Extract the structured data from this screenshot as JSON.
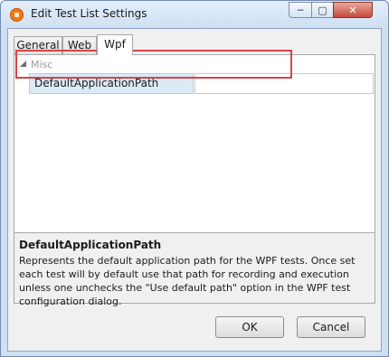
{
  "window": {
    "title": "Edit Test List Settings",
    "app_icon": "test-studio-icon",
    "controls": {
      "minimize_glyph": "─",
      "maximize_glyph": "▢",
      "close_glyph": "✕"
    }
  },
  "tabs": [
    {
      "label": "General",
      "selected": false
    },
    {
      "label": "Web",
      "selected": false
    },
    {
      "label": "Wpf",
      "selected": true
    }
  ],
  "property_grid": {
    "category": "Misc",
    "rows": [
      {
        "name": "DefaultApplicationPath",
        "value": ""
      }
    ]
  },
  "description": {
    "title": "DefaultApplicationPath",
    "text": "Represents the default application path for the WPF tests. Once set each test will by default use that path for recording and execution unless one unchecks the \"Use default path\" option in the WPF test configuration dialog."
  },
  "buttons": {
    "ok": "OK",
    "cancel": "Cancel"
  },
  "colors": {
    "highlight": "#d9434a",
    "selected_row": "#dbeaf5"
  }
}
